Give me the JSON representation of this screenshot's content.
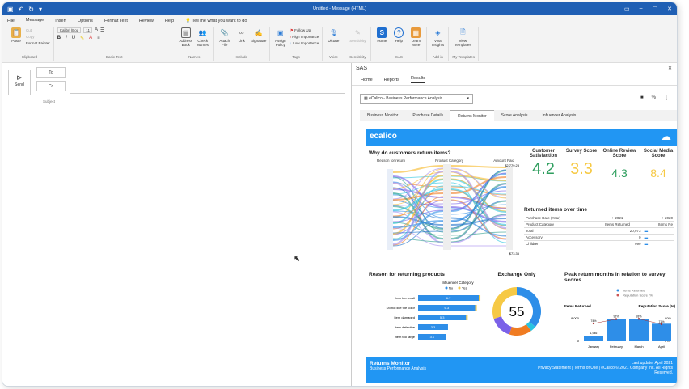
{
  "window": {
    "title": "Untitled - Message (HTML)"
  },
  "menu": [
    "File",
    "Message",
    "Insert",
    "Options",
    "Format Text",
    "Review",
    "Help"
  ],
  "tell_me": "Tell me what you want to do",
  "ribbon": {
    "clipboard": {
      "label": "Clipboard",
      "paste": "Paste",
      "cut": "Cut",
      "copy": "Copy",
      "format_painter": "Format Painter"
    },
    "basic_text": {
      "label": "Basic Text",
      "font": "Calibri (Bod",
      "size": "11"
    },
    "names": {
      "label": "Names",
      "address_book": "Address Book",
      "check_names": "Check Names"
    },
    "include": {
      "label": "Include",
      "attach": "Attach File",
      "link": "Link",
      "signature": "Signature"
    },
    "tags": {
      "label": "Tags",
      "assign_policy": "Assign Policy",
      "follow_up": "Follow Up",
      "high": "High Importance",
      "low": "Low Importance"
    },
    "voice": {
      "label": "Voice",
      "dictate": "Dictate"
    },
    "sensitivity": {
      "label": "Sensitivity",
      "btn": "Sensitivity"
    },
    "sas": {
      "label": "SAS",
      "home": "Home",
      "help": "Help",
      "learn": "Learn More"
    },
    "addin": {
      "label": "Add-in",
      "viva": "Viva Insights"
    },
    "templates": {
      "label": "My Templates",
      "view": "View Templates"
    }
  },
  "compose": {
    "send": "Send",
    "to": "To",
    "cc": "Cc",
    "subject": "Subject"
  },
  "sas": {
    "title": "SAS",
    "tabs": [
      "Home",
      "Reports",
      "Results"
    ],
    "report_select": "eCalico - Business Performance Analysis",
    "report_tabs": [
      "Business Monitor",
      "Purchase Details",
      "Returns Monitor",
      "Score Analysis",
      "Influencer Analysis"
    ],
    "brand": "ecalico",
    "sankey": {
      "title": "Why do customers return items?",
      "cols": [
        "Reason for return",
        "Product Category",
        "Amount Paid"
      ],
      "max": "$2,779.23",
      "min": "$73.35"
    },
    "kpis": [
      {
        "label": "Customer Satisfaction",
        "value": "4.2",
        "color": "#2e9e5e"
      },
      {
        "label": "Survey Score",
        "value": "3.3",
        "color": "#f6c945"
      },
      {
        "label": "Online Review Score",
        "value": "4.3",
        "color": "#2e9e5e"
      },
      {
        "label": "Social Media Score",
        "value": "8.4",
        "color": "#f6c945"
      }
    ],
    "returned": {
      "title": "Returned items over time",
      "purchase_date": "Purchase Date (Year)",
      "y2021": "+ 2021",
      "y2020": "+ 2020",
      "product_category": "Product Category",
      "items_returned": "Items Returned",
      "items_re": "Items Re",
      "rows": [
        {
          "c": "Total",
          "v": "20,973"
        },
        {
          "c": "Accessory",
          "v": "0"
        },
        {
          "c": "Children",
          "v": "999"
        }
      ]
    },
    "reasons": {
      "title": "Reason for returning products",
      "legend_title": "Influencer Category",
      "legend": [
        "No",
        "Yes"
      ],
      "colors": [
        "#2e8ee8",
        "#f6c945"
      ],
      "items": [
        {
          "label": "Item too small",
          "value": 6.7
        },
        {
          "label": "Do not like the color",
          "value": 6.3
        },
        {
          "label": "Item damaged",
          "value": 5.3
        },
        {
          "label": "Item defective",
          "value": 3.3
        },
        {
          "label": "Item too large",
          "value": 3.1
        }
      ]
    },
    "exchange": {
      "title": "Exchange Only",
      "value": "55"
    },
    "peak": {
      "title": "Peak return months in relation to survey scores",
      "legend": [
        "Items Returned",
        "Reputation Score (%)"
      ],
      "yleft": "Items Returned",
      "yright": "Reputation Score (%)",
      "yticks_left": [
        "8,000",
        "0"
      ],
      "yticks_right": [
        "80%",
        "0%"
      ],
      "months": [
        "January",
        "February",
        "March",
        "April"
      ],
      "items": [
        1946,
        8000,
        8000,
        6200
      ],
      "bar_labels": [
        "1,946",
        "",
        "",
        ""
      ],
      "scores": [
        "74%",
        "92%",
        "93%",
        "71%"
      ],
      "score_values": [
        74,
        92,
        93,
        71
      ]
    },
    "footer": {
      "title": "Returns Monitor",
      "subtitle": "Business Performance Analysis",
      "update": "Last update: April 2021",
      "links": "Privacy Statement | Terms of Use | eCalico © 2021 Company Inc. All Rights Reserved."
    }
  }
}
